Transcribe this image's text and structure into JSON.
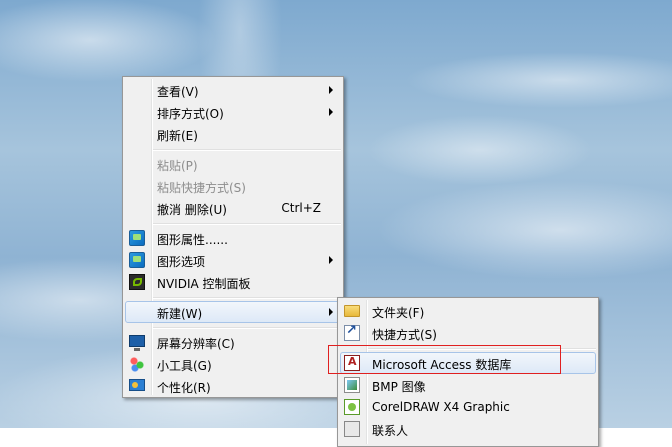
{
  "context_menu": {
    "items": [
      {
        "label": "查看(V)",
        "submenu": true
      },
      {
        "label": "排序方式(O)",
        "submenu": true
      },
      {
        "label": "刷新(E)"
      },
      {
        "label": "粘贴(P)",
        "disabled": true
      },
      {
        "label": "粘贴快捷方式(S)",
        "disabled": true
      },
      {
        "label": "撤消 删除(U)",
        "accelerator": "Ctrl+Z"
      },
      {
        "label": "图形属性......",
        "icon": "graphics-properties-icon"
      },
      {
        "label": "图形选项",
        "icon": "graphics-options-icon",
        "submenu": true
      },
      {
        "label": "NVIDIA 控制面板",
        "icon": "nvidia-icon"
      },
      {
        "label": "新建(W)",
        "submenu": true,
        "highlighted": true
      },
      {
        "label": "屏幕分辨率(C)",
        "icon": "monitor-icon"
      },
      {
        "label": "小工具(G)",
        "icon": "gadgets-icon"
      },
      {
        "label": "个性化(R)",
        "icon": "personalize-icon"
      }
    ]
  },
  "new_submenu": {
    "items": [
      {
        "label": "文件夹(F)",
        "icon": "folder-icon"
      },
      {
        "label": "快捷方式(S)",
        "icon": "shortcut-icon"
      },
      {
        "label": "Microsoft Access 数据库",
        "icon": "access-icon",
        "highlighted": true
      },
      {
        "label": "BMP 图像",
        "icon": "bmp-icon"
      },
      {
        "label": "CorelDRAW X4 Graphic",
        "icon": "coreldraw-icon"
      },
      {
        "label": "联系人",
        "icon": "contact-icon"
      }
    ]
  },
  "colors": {
    "menu_background": "#f0f0f0",
    "hover_border": "#a7c4e8",
    "annotation_box": "#e02020",
    "disabled_text": "#8d8d8d"
  }
}
